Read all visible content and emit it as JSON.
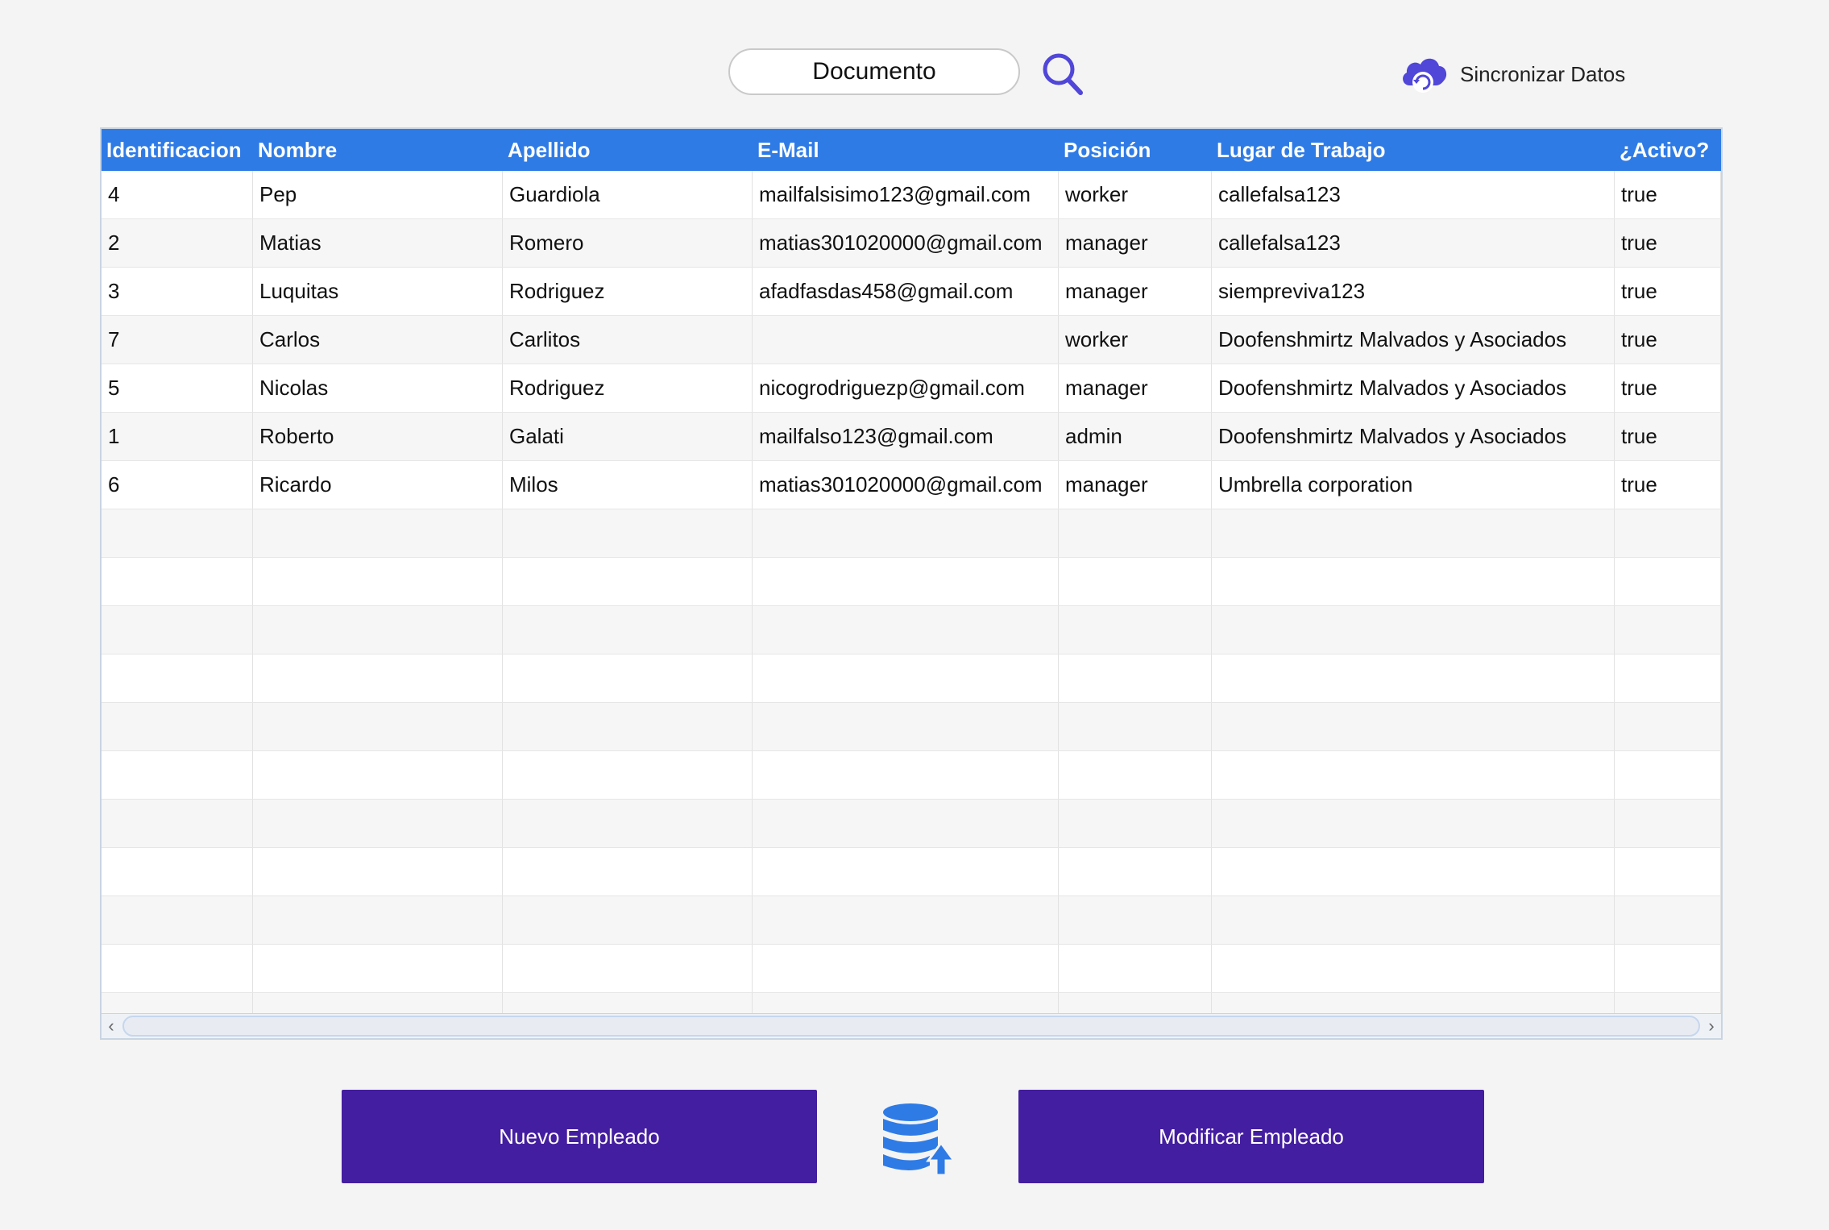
{
  "search": {
    "placeholder": "Documento"
  },
  "sync": {
    "label": "Sincronizar Datos"
  },
  "colors": {
    "header": "#2f7be6",
    "button": "#441ea0",
    "search_icon": "#5046d8",
    "db_icon": "#2f7be6"
  },
  "icons": {
    "search": "search-icon",
    "sync": "cloud-sync-icon",
    "db": "database-upload-icon"
  },
  "table": {
    "columns": [
      "Identificacion",
      "Nombre",
      "Apellido",
      "E-Mail",
      "Posición",
      "Lugar de Trabajo",
      "¿Activo?"
    ],
    "rows": [
      [
        "4",
        "Pep",
        "Guardiola",
        "mailfalsisimo123@gmail.com",
        "worker",
        "callefalsa123",
        "true"
      ],
      [
        "2",
        "Matias",
        "Romero",
        "matias301020000@gmail.com",
        "manager",
        "callefalsa123",
        "true"
      ],
      [
        "3",
        "Luquitas",
        "Rodriguez",
        "afadfasdas458@gmail.com",
        "manager",
        "siempreviva123",
        "true"
      ],
      [
        "7",
        "Carlos",
        "Carlitos",
        "",
        "worker",
        "Doofenshmirtz Malvados y Asociados",
        "true"
      ],
      [
        "5",
        "Nicolas",
        "Rodriguez",
        "nicogrodriguezp@gmail.com",
        "manager",
        "Doofenshmirtz Malvados y Asociados",
        "true"
      ],
      [
        "1",
        "Roberto",
        "Galati",
        "mailfalso123@gmail.com",
        "admin",
        "Doofenshmirtz Malvados y Asociados",
        "true"
      ],
      [
        "6",
        "Ricardo",
        "Milos",
        "matias301020000@gmail.com",
        "manager",
        "Umbrella corporation",
        "true"
      ]
    ]
  },
  "actions": {
    "new_label": "Nuevo Empleado",
    "modify_label": "Modificar Empleado"
  }
}
